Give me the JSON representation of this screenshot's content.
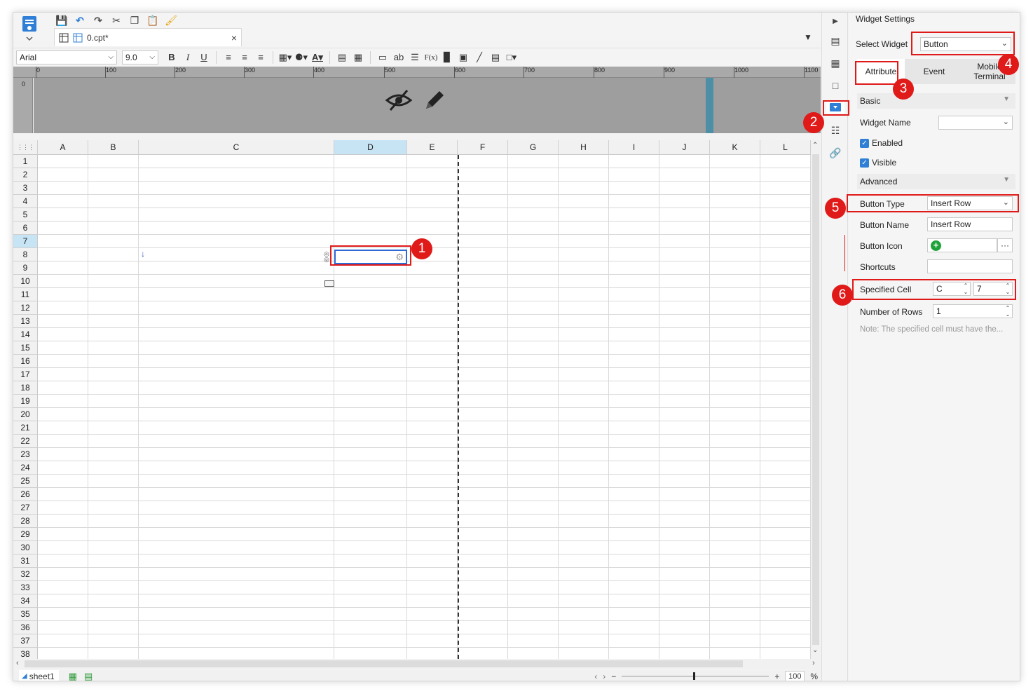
{
  "doc_tab": {
    "name": "0.cpt*",
    "close": "×"
  },
  "toolbar": {
    "font": "Arial",
    "size": "9.0",
    "bold": "B",
    "italic": "I",
    "underline": "U",
    "text_tool": "ab",
    "formula_tool": "F(x)"
  },
  "ruler": {
    "ticks": [
      "0",
      "100",
      "200",
      "300",
      "400",
      "500",
      "600",
      "700",
      "800",
      "900",
      "1000",
      "1100"
    ],
    "vertical_zero": "0"
  },
  "grid": {
    "columns": [
      "A",
      "B",
      "C",
      "D",
      "E",
      "F",
      "G",
      "H",
      "I",
      "J",
      "K",
      "L"
    ],
    "rows": [
      "1",
      "2",
      "3",
      "4",
      "5",
      "6",
      "7",
      "8",
      "9",
      "10",
      "11",
      "12",
      "13",
      "14",
      "15",
      "16",
      "17",
      "18",
      "19",
      "20",
      "21",
      "22",
      "23",
      "24",
      "25",
      "26",
      "27",
      "28",
      "29",
      "30",
      "31",
      "32",
      "33",
      "34",
      "35",
      "36",
      "37",
      "38"
    ],
    "selected_column": "D",
    "selected_row": "7"
  },
  "sheetbar": {
    "sheet_name": "sheet1",
    "zoom_value": "100",
    "zoom_unit": "%",
    "zoom_minus": "−",
    "zoom_plus": "+"
  },
  "panel": {
    "title": "Widget Settings",
    "select_widget_label": "Select Widget",
    "select_widget_value": "Button",
    "tabs": {
      "attribute": "Attribute",
      "event": "Event",
      "mobile": "Mobile Terminal"
    },
    "basic": "Basic",
    "widget_name_label": "Widget Name",
    "widget_name_value": "",
    "enabled_label": "Enabled",
    "visible_label": "Visible",
    "advanced": "Advanced",
    "button_type_label": "Button Type",
    "button_type_value": "Insert Row",
    "button_name_label": "Button Name",
    "button_name_value": "Insert Row",
    "button_icon_label": "Button Icon",
    "button_icon_more": "···",
    "shortcuts_label": "Shortcuts",
    "shortcuts_value": "",
    "specified_cell_label": "Specified Cell",
    "specified_cell_col": "C",
    "specified_cell_row": "7",
    "rows_label": "Number of Rows",
    "rows_value": "1",
    "note": "Note: The specified cell must have the..."
  },
  "callouts": [
    "1",
    "2",
    "3",
    "4",
    "5",
    "6"
  ],
  "colors": {
    "highlight": "#e01919",
    "selection": "#2e6ad6",
    "header_selected": "#c7e4f5",
    "checkbox": "#2f7fd6",
    "accent_bar": "#4e8fa8"
  }
}
